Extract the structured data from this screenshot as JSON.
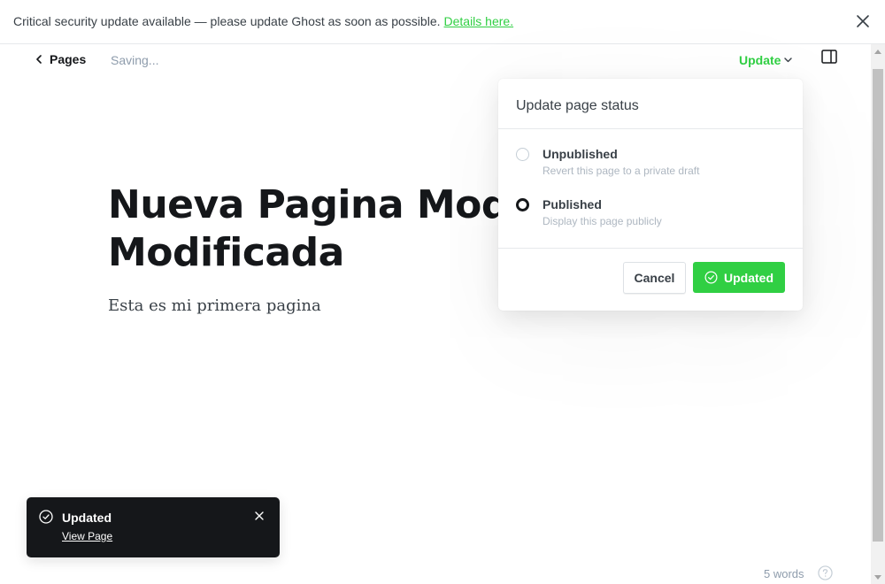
{
  "banner": {
    "message": "Critical security update available — please update Ghost as soon as possible.",
    "link_label": "Details here.",
    "close_icon": "close-icon"
  },
  "header": {
    "back_label": "Pages",
    "status": "Saving...",
    "update_label": "Update",
    "sidebar_icon": "sidebar-toggle-icon"
  },
  "editor": {
    "title": "Nueva Pagina Modificada Modificada",
    "body": "Esta es mi primera pagina"
  },
  "publish_popover": {
    "title": "Update page status",
    "options": [
      {
        "label": "Unpublished",
        "description": "Revert this page to a private draft",
        "selected": false
      },
      {
        "label": "Published",
        "description": "Display this page publicly",
        "selected": true
      }
    ],
    "cancel_label": "Cancel",
    "confirm_label": "Updated"
  },
  "toast": {
    "title": "Updated",
    "link_label": "View Page"
  },
  "footer": {
    "word_count": "5 words",
    "help_icon": "help-icon"
  },
  "colors": {
    "accent": "#30cf43",
    "text": "#15171a",
    "muted": "#8e9cac",
    "toast_bg": "#15171a"
  }
}
